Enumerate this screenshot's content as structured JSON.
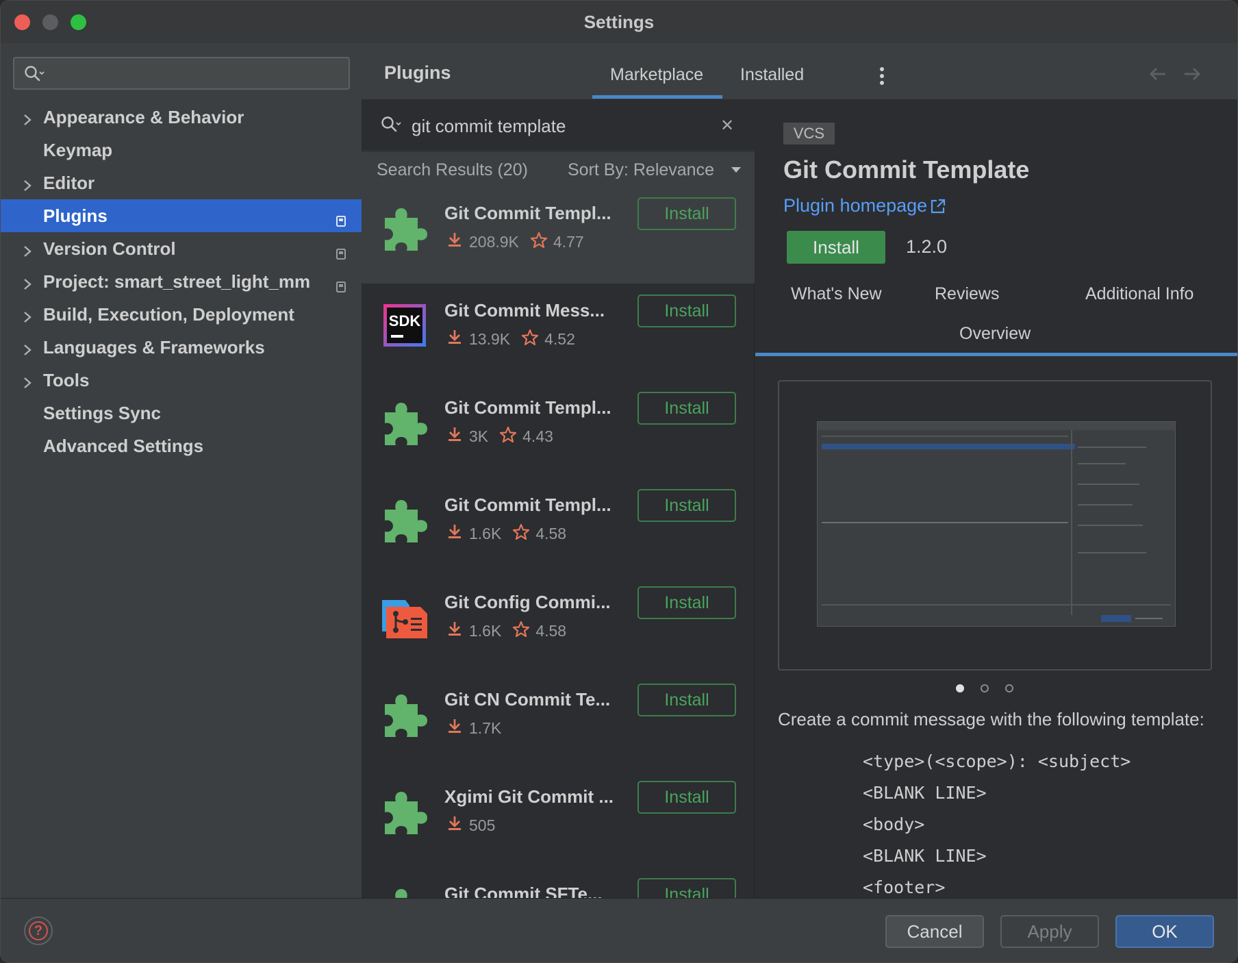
{
  "window": {
    "title": "Settings"
  },
  "sidebar": {
    "search_placeholder": "",
    "items": [
      {
        "label": "Appearance & Behavior",
        "expandable": true,
        "badge": false
      },
      {
        "label": "Keymap",
        "expandable": false,
        "badge": false
      },
      {
        "label": "Editor",
        "expandable": true,
        "badge": false
      },
      {
        "label": "Plugins",
        "expandable": false,
        "badge": true,
        "selected": true
      },
      {
        "label": "Version Control",
        "expandable": true,
        "badge": true
      },
      {
        "label": "Project: smart_street_light_mm",
        "expandable": true,
        "badge": true
      },
      {
        "label": "Build, Execution, Deployment",
        "expandable": true,
        "badge": false
      },
      {
        "label": "Languages & Frameworks",
        "expandable": true,
        "badge": false
      },
      {
        "label": "Tools",
        "expandable": true,
        "badge": false
      },
      {
        "label": "Settings Sync",
        "expandable": false,
        "badge": false
      },
      {
        "label": "Advanced Settings",
        "expandable": false,
        "badge": false
      }
    ]
  },
  "header": {
    "title": "Plugins",
    "tabs": {
      "marketplace": "Marketplace",
      "installed": "Installed"
    },
    "active_tab": "Marketplace"
  },
  "list": {
    "search_value": "git commit template",
    "results_label": "Search Results (20)",
    "sort_label": "Sort By: Relevance",
    "plugins": [
      {
        "name": "Git Commit Templ...",
        "downloads": "208.9K",
        "rating": "4.77",
        "icon": "puzzle-icon",
        "button": "Install"
      },
      {
        "name": "Git Commit Mess...",
        "downloads": "13.9K",
        "rating": "4.52",
        "icon": "sdk-icon",
        "button": "Install"
      },
      {
        "name": "Git Commit Templ...",
        "downloads": "3K",
        "rating": "4.43",
        "icon": "puzzle-icon",
        "button": "Install"
      },
      {
        "name": "Git Commit Templ...",
        "downloads": "1.6K",
        "rating": "4.58",
        "icon": "puzzle-icon",
        "button": "Install"
      },
      {
        "name": "Git Config Commi...",
        "downloads": "1.6K",
        "rating": "4.58",
        "icon": "git-config-icon",
        "button": "Install"
      },
      {
        "name": "Git CN Commit Te...",
        "downloads": "1.7K",
        "rating": "",
        "icon": "puzzle-icon",
        "button": "Install"
      },
      {
        "name": "Xgimi Git Commit ...",
        "downloads": "505",
        "rating": "",
        "icon": "puzzle-icon",
        "button": "Install"
      },
      {
        "name": "Git Commit SFTe...",
        "downloads": "",
        "rating": "",
        "icon": "puzzle-icon",
        "button": "Install"
      }
    ]
  },
  "detail": {
    "tag": "VCS",
    "title": "Git Commit Template",
    "homepage_label": "Plugin homepage",
    "install_label": "Install",
    "version": "1.2.0",
    "tabs": {
      "whats_new": "What's New",
      "reviews": "Reviews",
      "additional_info": "Additional Info",
      "overview": "Overview"
    },
    "active_tab": "Overview",
    "description": "Create a commit message with the following template:",
    "template_lines": [
      "<type>(<scope>): <subject>",
      "<BLANK LINE>",
      "<body>",
      "<BLANK LINE>",
      "<footer>"
    ],
    "carousel_index": 1,
    "carousel_total": 3
  },
  "footer": {
    "help_label": "?",
    "cancel": "Cancel",
    "apply": "Apply",
    "ok": "OK"
  },
  "colors": {
    "accent_blue": "#2f65ca",
    "install_green": "#3b8b4c",
    "link_blue": "#589df6"
  }
}
